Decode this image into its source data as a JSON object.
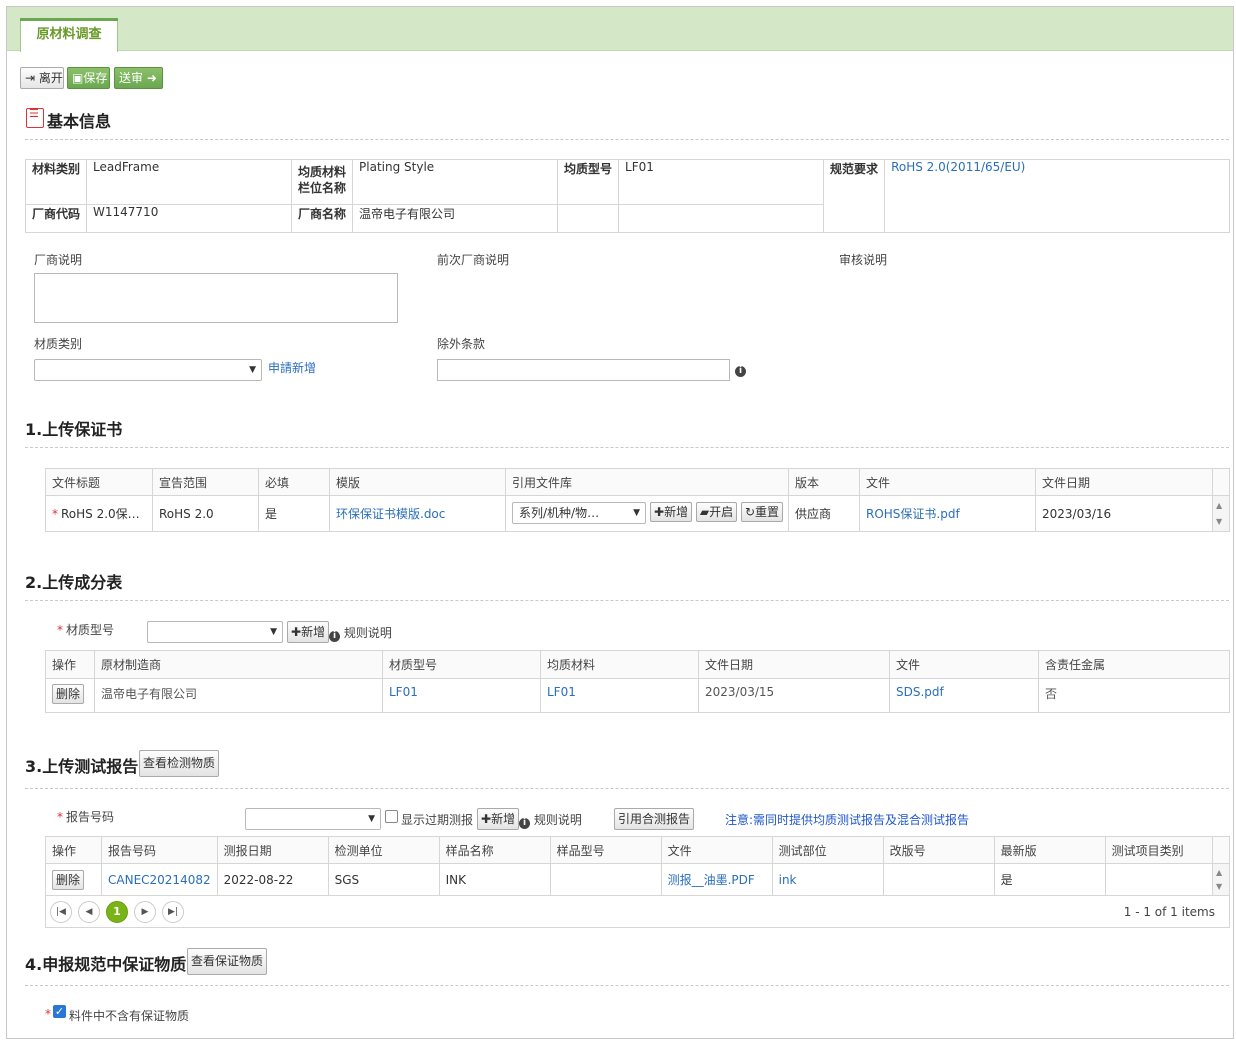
{
  "tab": {
    "label": "原材料调查"
  },
  "toolbar": {
    "leave": "离开",
    "save": "保存",
    "submit": "送审"
  },
  "basic": {
    "title": "基本信息",
    "material_type_k": "材料类别",
    "material_type_v": "LeadFrame",
    "homog_col_k": "均质材料栏位名称",
    "homog_col_v": "Plating Style",
    "homog_model_k": "均质型号",
    "homog_model_v": "LF01",
    "spec_k": "规范要求",
    "spec_v": "RoHS 2.0(2011/65/EU)",
    "vendor_code_k": "厂商代码",
    "vendor_code_v": "W1147710",
    "vendor_name_k": "厂商名称",
    "vendor_name_v": "温帝电子有限公司",
    "vendor_note": "厂商说明",
    "prev_vendor_note": "前次厂商说明",
    "review_note": "审核说明",
    "substance_type": "材质类别",
    "apply_new": "申請新增",
    "exemption": "除外条款"
  },
  "s1": {
    "title": "1.上传保证书",
    "headers": [
      "文件标题",
      "宣告范围",
      "必填",
      "模版",
      "引用文件库",
      "版本",
      "文件",
      "文件日期"
    ],
    "row": {
      "title": "RoHS 2.0保…",
      "scope": "RoHS 2.0",
      "required": "是",
      "template": "环保保证书模版.doc",
      "lib_select": "系列/机种/物…",
      "btn_add": "新增",
      "btn_open": "开启",
      "btn_reset": "重置",
      "version": "供应商",
      "file": "ROHS保证书.pdf",
      "date": "2023/03/16"
    }
  },
  "s2": {
    "title": "2.上传成分表",
    "model_label": "材质型号",
    "btn_add": "新增",
    "rule": "规则说明",
    "headers": [
      "操作",
      "原材制造商",
      "材质型号",
      "均质材料",
      "文件日期",
      "文件",
      "含责任金属"
    ],
    "row": {
      "op": "删除",
      "maker": "温帝电子有限公司",
      "model": "LF01",
      "homog": "LF01",
      "date": "2023/03/15",
      "file": "SDS.pdf",
      "metal": "否"
    }
  },
  "s3": {
    "title": "3.上传测试报告",
    "view_btn": "查看检测物质",
    "report_label": "报告号码",
    "show_expired": "显示过期测报",
    "btn_add": "新增",
    "rule": "规则说明",
    "ref_btn": "引用合测报告",
    "notice": "注意:需同时提供均质测试报告及混合测试报告",
    "headers": [
      "操作",
      "报告号码",
      "测报日期",
      "检测单位",
      "样品名称",
      "样品型号",
      "文件",
      "测试部位",
      "改版号",
      "最新版",
      "测试项目类别"
    ],
    "row": {
      "op": "删除",
      "report": "CANEC20214082",
      "date": "2022-08-22",
      "lab": "SGS",
      "sample": "INK",
      "sample_model": "",
      "file": "测报__油墨.PDF",
      "part": "ink",
      "rev": "",
      "latest": "是",
      "cat": ""
    },
    "pager": {
      "current": "1",
      "summary": "1 - 1 of 1 items"
    }
  },
  "s4": {
    "title": "4.申报规范中保证物质",
    "view_btn": "查看保证物质",
    "checkbox_label": "料件中不含有保证物质",
    "checked": true
  },
  "colors": {
    "accent_green": "#6aa84f",
    "tab_bg": "#d4e8c8",
    "link": "#2a6ebb",
    "required": "#d33333"
  }
}
